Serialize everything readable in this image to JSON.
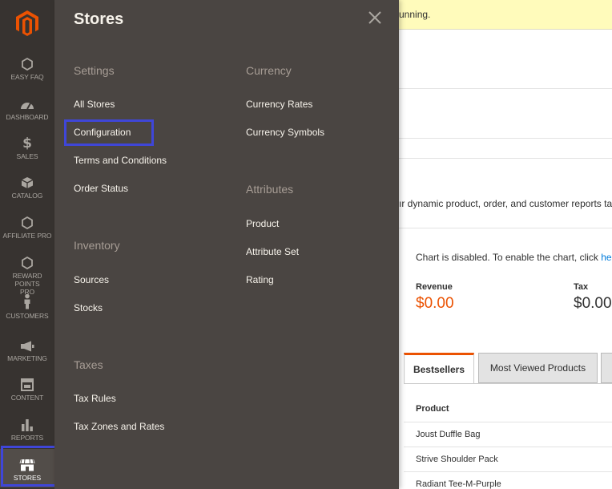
{
  "notice": {
    "text": "unning."
  },
  "page": {
    "report_text": "ır dynamic product, order, and customer reports ta",
    "chart_message": "Chart is disabled. To enable the chart, click ",
    "chart_link": "here",
    "revenue_label": "Revenue",
    "revenue_value": "$0.00",
    "tax_label": "Tax",
    "tax_value": "$0.00",
    "tabs": {
      "active": "Bestsellers",
      "second": "Most Viewed Products"
    },
    "table": {
      "header": "Product",
      "rows": [
        "Joust Duffle Bag",
        "Strive Shoulder Pack",
        "Radiant Tee-M-Purple"
      ]
    }
  },
  "sidebar": {
    "items": [
      {
        "label": "EASY FAQ",
        "icon": "hexagon-icon"
      },
      {
        "label": "DASHBOARD",
        "icon": "speedometer-icon"
      },
      {
        "label": "SALES",
        "icon": "dollar-icon"
      },
      {
        "label": "CATALOG",
        "icon": "box-icon"
      },
      {
        "label": "AFFILIATE PRO",
        "icon": "hexagon-icon"
      },
      {
        "label": "REWARD POINTS PRO",
        "icon": "hexagon-icon"
      },
      {
        "label": "CUSTOMERS",
        "icon": "person-icon"
      },
      {
        "label": "MARKETING",
        "icon": "megaphone-icon"
      },
      {
        "label": "CONTENT",
        "icon": "layout-icon"
      },
      {
        "label": "REPORTS",
        "icon": "bar-chart-icon"
      },
      {
        "label": "STORES",
        "icon": "storefront-icon"
      }
    ]
  },
  "flyout": {
    "title": "Stores",
    "settings": {
      "title": "Settings",
      "links": [
        "All Stores",
        "Configuration",
        "Terms and Conditions",
        "Order Status"
      ]
    },
    "inventory": {
      "title": "Inventory",
      "links": [
        "Sources",
        "Stocks"
      ]
    },
    "taxes": {
      "title": "Taxes",
      "links": [
        "Tax Rules",
        "Tax Zones and Rates"
      ]
    },
    "currency": {
      "title": "Currency",
      "links": [
        "Currency Rates",
        "Currency Symbols"
      ]
    },
    "attributes": {
      "title": "Attributes",
      "links": [
        "Product",
        "Attribute Set",
        "Rating"
      ]
    }
  },
  "colors": {
    "accent": "#eb5202",
    "highlight": "#3f46d8",
    "sidebar": "#373330",
    "flyout": "#4a4542"
  }
}
